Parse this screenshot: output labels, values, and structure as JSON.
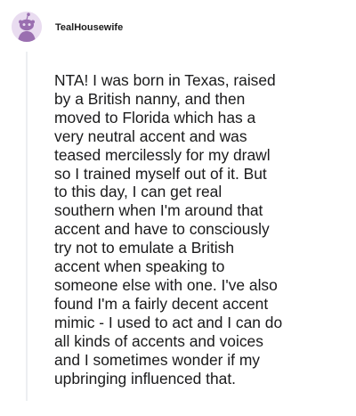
{
  "comment": {
    "username": "TealHousewife",
    "avatar_icon": "snoo-avatar-icon",
    "avatar_colors": {
      "background": "#e9dcf0",
      "figure": "#9a6fb0"
    },
    "body": "NTA! I was born in Texas, raised\nby a British nanny, and then\nmoved to Florida which has a\nvery neutral accent and was\nteased mercilessly for my drawl\nso I trained myself out of it. But\nto this day, I can get real\nsouthern when I'm around that\naccent and have to consciously\ntry not to emulate a British\naccent when speaking to\nsomeone else with one. I've also\nfound I'm a fairly decent accent\nmimic - I used to act and I can do\nall kinds of accents and voices\nand I sometimes wonder if my\nupbringing influenced that."
  }
}
